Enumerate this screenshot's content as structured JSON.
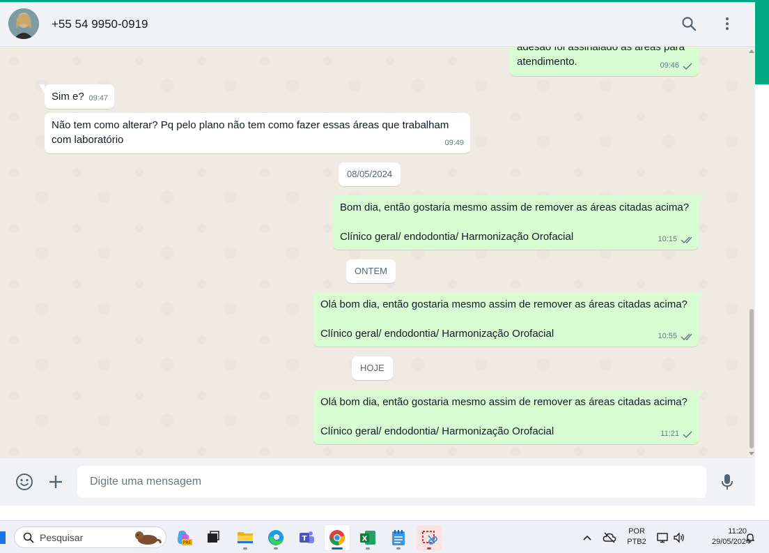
{
  "window": {
    "accent_color": "#00a884"
  },
  "header": {
    "contact_name": "+55 54 9950-0919",
    "icons": [
      "search-icon",
      "menu-dots-icon"
    ]
  },
  "chat": {
    "messages": [
      {
        "dir": "out",
        "text": "adesão foi assinalado as áreas para\natendimento.",
        "time": "09:46",
        "status": "sent"
      },
      {
        "dir": "in",
        "text": "Sim e?",
        "time": "09:47"
      },
      {
        "dir": "in",
        "text": "Não tem como alterar? Pq pelo plano não tem como fazer essas áreas que trabalham\ncom laboratório",
        "time": "09:49"
      },
      {
        "dir": "out",
        "text": "Bom dia, então gostaria mesmo assim de remover as áreas citadas acima?\n\nClínico geral/ endodontia/ Harmonização Orofacial",
        "time": "10:15",
        "status": "delivered"
      },
      {
        "dir": "out",
        "text": "Olá bom dia, então gostaria mesmo assim de remover as áreas citadas acima?\n\nClínico geral/ endodontia/ Harmonização Orofacial",
        "time": "10:55",
        "status": "delivered"
      },
      {
        "dir": "out",
        "text": "Olá bom dia, então gostaria mesmo assim de remover as áreas citadas acima?\n\nClínico geral/ endodontia/ Harmonização Orofacial",
        "time": "11:21",
        "status": "sent"
      }
    ],
    "date_separators": [
      "08/05/2024",
      "ONTEM",
      "HOJE"
    ]
  },
  "composer": {
    "placeholder": "Digite uma mensagem",
    "icons": [
      "emoji-icon",
      "attach-plus-icon",
      "microphone-icon"
    ]
  },
  "taskbar": {
    "search_placeholder": "Pesquisar",
    "apps": [
      "copilot-icon",
      "task-view-icon",
      "file-explorer-icon",
      "edge-icon",
      "teams-icon",
      "chrome-icon",
      "excel-icon",
      "notepad-icon",
      "snipping-tool-icon"
    ],
    "active_app": "chrome-icon",
    "language_line1": "POR",
    "language_line2": "PTB2",
    "time": "11:20",
    "date": "29/05/2024"
  }
}
